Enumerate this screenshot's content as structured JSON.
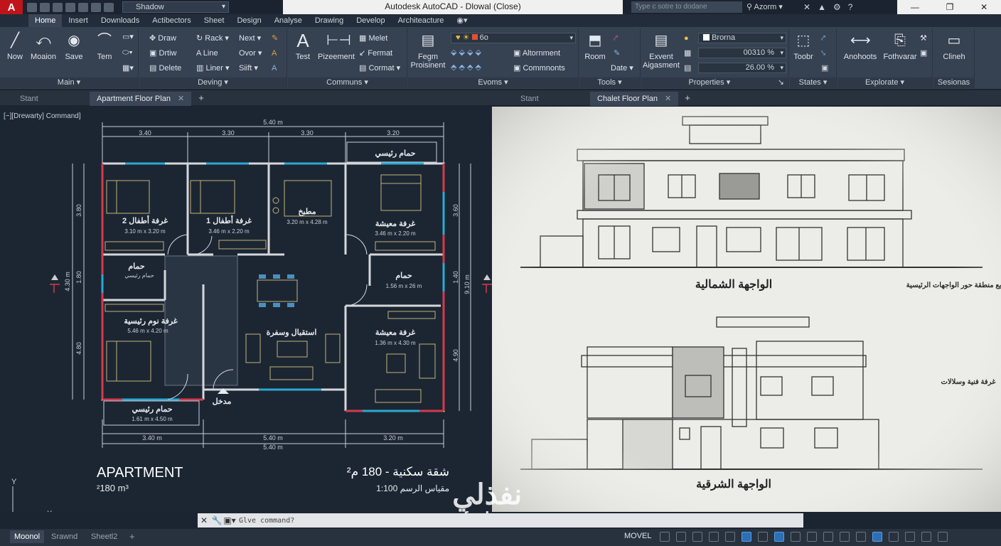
{
  "titlebar": {
    "logo": "A",
    "workspace": "Shadow",
    "window_title": "Autodesk AutoCAD - Dlowal (Close)",
    "search_placeholder": "Type c sotre to dodane",
    "user": "Azorm"
  },
  "ribbon_tabs": [
    "Home",
    "Insert",
    "Downloads",
    "Actibectors",
    "Sheet",
    "Design",
    "Analyse",
    "Drawing",
    "Develop",
    "Architeacture"
  ],
  "ribbon": {
    "main": {
      "title": "Main",
      "buttons": [
        "Now",
        "Moaion",
        "Save",
        "Tem"
      ]
    },
    "deving": {
      "title": "Deving",
      "items": [
        "Draw",
        "Drtiw",
        "Delete",
        "Rack",
        "Line",
        "Liner",
        "Next",
        "Ovor",
        "Siift"
      ]
    },
    "communs": {
      "title": "Communs",
      "buttons": [
        "Test",
        "Pizeement"
      ],
      "items": [
        "Melet",
        "Fermat",
        "Cormat"
      ]
    },
    "evoms": {
      "title": "Evoms",
      "button": "Fegm Proisinent",
      "select": "6o",
      "items": [
        "Altornment",
        "Commnonts"
      ]
    },
    "tools": {
      "title": "Tools",
      "button": "Room",
      "item": "Date"
    },
    "properties": {
      "title": "Properties",
      "button": "Exvent Aigasment",
      "layer": "Brorna",
      "lw1": "00310 %",
      "lw2": "26.00 %"
    },
    "states": {
      "title": "States",
      "button": "Toobr"
    },
    "explorate": {
      "title": "Explorate",
      "buttons": [
        "Anohoots",
        "Fothvarar"
      ]
    },
    "sections": {
      "title": "Sesionas",
      "button": "Clineh"
    }
  },
  "doc_tabs_left": [
    "Stant",
    "Apartment Floor Plan"
  ],
  "doc_tabs_right": [
    "Stant",
    "Chalet Floor Plan"
  ],
  "viewport_label": "[−][Drewarty] Command]",
  "plan": {
    "dims_top_total": "5.40 m",
    "dims_top": [
      "3.40",
      "3.30",
      "3.30",
      "3.20"
    ],
    "dims_bottom": [
      "3.40 m",
      "5.40 m",
      "3.20 m"
    ],
    "dims_bottom_total": "5.40 m",
    "dims_left": [
      "3.80",
      "1.80",
      "4.80"
    ],
    "dims_left_total": "4.30 m",
    "dims_right": [
      "3.60",
      "1.40",
      "4.90"
    ],
    "dims_right_total": "9.10 m",
    "rooms": [
      {
        "name": "غرفة أطفال 2",
        "size": "3.10 m x 3.20 m"
      },
      {
        "name": "غرفة أطفال 1",
        "size": "3.46 m x 2.20 m"
      },
      {
        "name": "مطبخ",
        "size": "3.20 m x 4.28 m"
      },
      {
        "name": "غرفة معيشة",
        "size": "3.46 m x 2.20 m"
      },
      {
        "name": "حمام",
        "size": "حمام رئيسي"
      },
      {
        "name": "حمام",
        "size": "1.56 m x 26 m"
      },
      {
        "name": "غرفة نوم رئيسية",
        "size": "5.46 m x 4.20 m"
      },
      {
        "name": "استقبال وسفرة",
        "size": ""
      },
      {
        "name": "غرفة معيشة",
        "size": "1.36 m x 4.30 m"
      },
      {
        "name": "حمام رئيسي",
        "size": "1.61 m x 4.50 m"
      },
      {
        "name": "حمام رئيسي",
        "size": ""
      }
    ],
    "entrance": "مدخل",
    "title_en": "APARTMENT",
    "area_en": "²180 m³",
    "title_ar": "شقة سكنية - 180 م²",
    "scale": "مقياس الرسم 1:100"
  },
  "elevations": {
    "north": "الواجهة الشمالية",
    "east": "الواجهة الشرقية",
    "note1": "توزيع منطقة حور الواجهات الرئيسية",
    "note2": "غرفة فنية وسلالات"
  },
  "command": {
    "placeholder": "Glve command?"
  },
  "layout_tabs": [
    "Moonol",
    "Srawnd",
    "Sheetl2"
  ],
  "status": {
    "model": "MOVEL"
  },
  "watermark": {
    "ar": "نفذلي",
    "en": "nafezly.com"
  },
  "colors": {
    "accent": "#c0141b",
    "bg": "#1c2633",
    "wall": "#d4d7db",
    "wall_red": "#d43a4a",
    "dim": "#c9ced6",
    "window": "#2aa9d2"
  }
}
